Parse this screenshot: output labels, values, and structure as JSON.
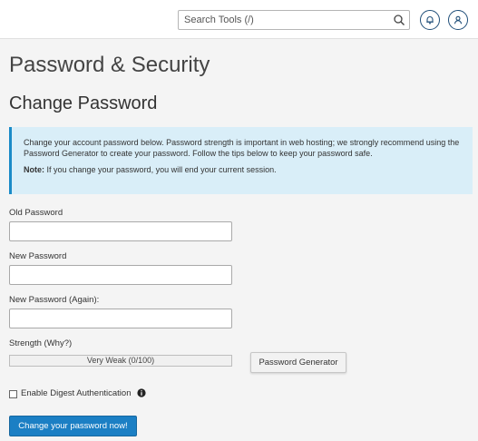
{
  "search": {
    "placeholder": "Search Tools (/)"
  },
  "page": {
    "title": "Password & Security",
    "subtitle": "Change Password"
  },
  "callout": {
    "text": "Change your account password below. Password strength is important in web hosting; we strongly recommend using the Password Generator to create your password. Follow the tips below to keep your password safe.",
    "note_label": "Note:",
    "note_text": " If you change your password, you will end your current session."
  },
  "form": {
    "old_label": "Old Password",
    "new_label": "New Password",
    "again_label": "New Password (Again):",
    "strength_label": "Strength (Why?)",
    "strength_text": "Very Weak (0/100)",
    "strength_value": 0,
    "generator_label": "Password Generator",
    "digest_label": "Enable Digest Authentication",
    "submit_label": "Change your password now!"
  },
  "icons": [
    "search-icon",
    "bell-icon",
    "user-icon",
    "info-icon"
  ],
  "colors": {
    "accent": "#1b7fc4",
    "callout_bg": "#d9eef8",
    "header_icon": "#1f4e79"
  }
}
